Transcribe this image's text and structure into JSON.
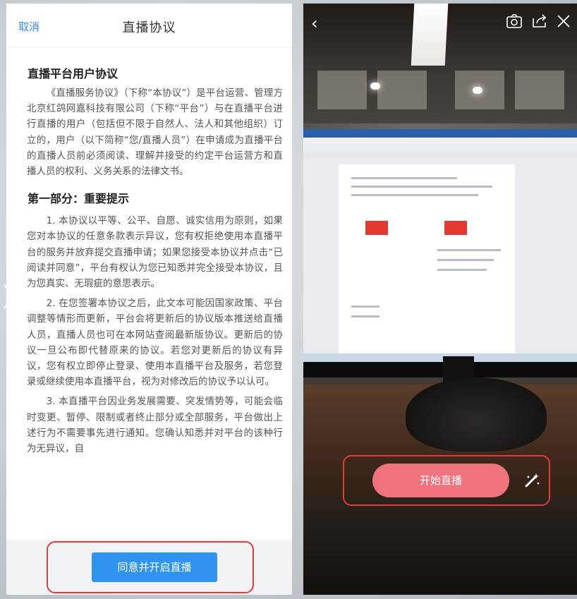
{
  "agreement": {
    "cancel_label": "取消",
    "title": "直播协议",
    "heading": "直播平台用户协议",
    "intro": "《直播服务协议》（下称“本协议”）是平台运营、管理方北京红鸽网嘉科技有限公司（下称“平台”）与在直播平台进行直播的用户（包括但不限于自然人、法人和其他组织）订立的，用户（以下简称“您/直播人员”）在申请成为直播平台的直播人员前必须阅读、理解并接受的约定平台运营方和直播人员的权利、义务关系的法律文书。",
    "section1_heading": "第一部分：重要提示",
    "clause1": "1. 本协议以平等、公平、自愿、诚实信用为原则，如果您对本协议的任意条款表示异议，您有权拒绝使用本直播平台的服务并放弃提交直播申请；如果您接受本协议并点击“已阅读并同意”，平台有权认为您已知悉并完全接受本协议，且为您真实、无瑕疵的意思表示。",
    "clause2": "2. 在您签署本协议之后，此文本可能因国家政策、平台调整等情形而更新，平台会将更新后的协议版本推送给直播人员，直播人员也可在本网站查阅最新版协议。更新后的协议一旦公布即代替原来的协议。若您对更新后的协议有异议，您有权立即停止登录、使用本直播平台及服务，若您登录或继续使用本直播平台，视为对修改后的协议予以认可。",
    "clause3": "3. 本直播平台因业务发展需要、突发情势等，可能会临时变更、暂停、限制或者终止部分或全部服务，平台做出上述行为不需要事先进行通知。您确认知悉并对平台的该种行为无异议，自",
    "agree_button": "同意并开启直播"
  },
  "camera": {
    "start_button": "开始直播",
    "icons": [
      "back-icon",
      "camera-flip-icon",
      "share-icon",
      "close-icon",
      "beauty-wand-icon"
    ],
    "highlight_color": "#e53a3a",
    "start_button_color": "#f0727c",
    "agree_button_color": "#2f94ef"
  }
}
